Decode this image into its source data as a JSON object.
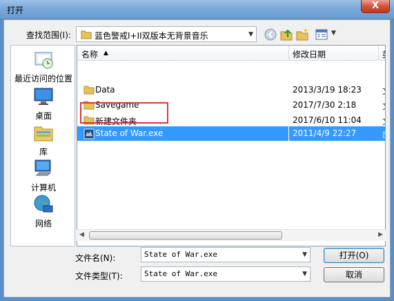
{
  "window": {
    "title": "打开",
    "close_label": "X"
  },
  "lookin": {
    "label": "查找范围(I):",
    "value": "蓝色警戒I+II双版本无背景音乐"
  },
  "places": [
    {
      "label": "最近访问的位置",
      "icon": "recent-places-icon"
    },
    {
      "label": "桌面",
      "icon": "desktop-icon"
    },
    {
      "label": "库",
      "icon": "libraries-icon"
    },
    {
      "label": "计算机",
      "icon": "computer-icon"
    },
    {
      "label": "网络",
      "icon": "network-icon"
    }
  ],
  "columns": {
    "name": "名称",
    "date": "修改日期",
    "type": "类"
  },
  "files": [
    {
      "name": "Data",
      "date": "2013/3/19 18:23",
      "type": "文",
      "icon": "folder-icon"
    },
    {
      "name": "Savegame",
      "date": "2017/7/30 2:18",
      "type": "文",
      "icon": "folder-icon"
    },
    {
      "name": "新建文件夹",
      "date": "2017/6/10 11:04",
      "type": "文",
      "icon": "folder-icon"
    },
    {
      "name": "State of War.exe",
      "date": "2011/4/9 22:27",
      "type": "应",
      "icon": "exe-icon",
      "selected": true
    }
  ],
  "filename": {
    "label": "文件名(N):",
    "value": "State of War.exe"
  },
  "filetype": {
    "label": "文件类型(T):",
    "value": "State of War.exe"
  },
  "buttons": {
    "open": "打开(O)",
    "cancel": "取消"
  },
  "colors": {
    "selection": "#3399ff",
    "highlight": "#dd3333",
    "titlebar": "#7aa8d8"
  }
}
